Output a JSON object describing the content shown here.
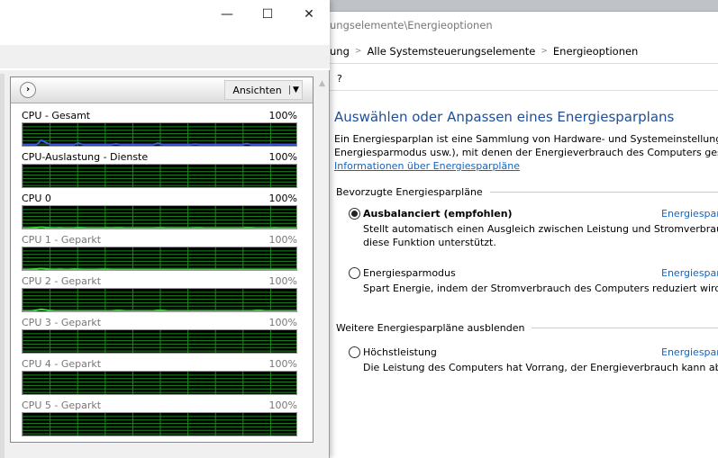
{
  "explorer": {
    "title": "ungselemente\\Energieoptionen",
    "breadcrumb": [
      "ung",
      "Alle Systemsteuerungselemente",
      "Energieoptionen"
    ],
    "help": "?",
    "heading": "Auswählen oder Anpassen eines Energiesparplans",
    "intro": [
      "Ein Energiesparplan ist eine Sammlung von Hardware- und Systemeinstellungen (",
      "Energiesparmodus usw.), mit denen der Energieverbrauch des Computers gesteu"
    ],
    "intro_link": "Informationen über Energiesparpläne",
    "group_preferred": "Bevorzugte Energiesparpläne",
    "group_more": "Weitere Energiesparpläne ausblenden",
    "plans": [
      {
        "name": "Ausbalanciert (empfohlen)",
        "selected": true,
        "link": "Energiesparp",
        "desc": [
          "Stellt automatisch einen Ausgleich zwischen Leistung und Stromverbrauch",
          "diese Funktion unterstützt."
        ]
      },
      {
        "name": "Energiesparmodus",
        "selected": false,
        "link": "Energiesparp",
        "desc": [
          "Spart Energie, indem der Stromverbrauch des Computers reduziert wird, we"
        ]
      },
      {
        "name": "Höchstleistung",
        "selected": false,
        "link": "Energiesparp",
        "desc": [
          "Die Leistung des Computers hat Vorrang, der Energieverbrauch kann aber h"
        ]
      }
    ]
  },
  "monitor": {
    "window_buttons": {
      "minimize": "—",
      "maximize": "☐",
      "close": "✕"
    },
    "views_label": "Ansichten",
    "expand_icon": "›",
    "graphs": [
      {
        "label": "CPU - Gesamt",
        "max": "100%",
        "parked": false,
        "color": "#3a5de8",
        "usage": [
          5,
          5,
          5,
          5,
          25,
          15,
          5,
          5,
          5,
          5,
          5,
          5,
          12,
          5,
          5,
          5,
          5,
          5,
          5,
          5,
          8,
          5,
          5,
          5,
          5,
          5,
          5,
          5,
          5,
          12,
          5,
          5,
          5,
          5,
          5,
          5,
          5,
          7,
          5,
          5,
          5,
          5,
          5,
          5,
          5,
          5,
          5,
          5,
          10,
          5,
          5,
          5,
          5,
          5,
          6,
          5,
          5,
          5,
          5,
          5
        ]
      },
      {
        "label": "CPU-Auslastung - Dienste",
        "max": "100%",
        "parked": false,
        "color": "#3a5de8",
        "usage": []
      },
      {
        "label": "CPU 0",
        "max": "100%",
        "parked": false,
        "color": "#30e030",
        "usage": [
          1,
          1,
          2,
          4,
          6,
          4,
          2,
          1,
          2,
          1,
          1,
          1,
          3,
          2,
          1,
          1,
          1,
          1,
          2,
          1,
          2,
          2,
          1,
          1,
          1,
          1,
          1,
          1,
          1,
          2,
          2,
          1,
          1,
          1,
          1,
          1,
          1,
          2,
          2,
          1,
          1,
          1,
          1,
          1,
          1,
          1,
          1,
          1,
          3,
          2,
          1,
          1,
          1,
          1,
          2,
          1,
          1,
          1,
          1,
          1
        ]
      },
      {
        "label": "CPU 1 - Geparkt",
        "max": "100%",
        "parked": true,
        "color": "#30e030",
        "usage": [
          1,
          1,
          2,
          4,
          6,
          4,
          2,
          1,
          2,
          1,
          1,
          3,
          2,
          1,
          1,
          1,
          1,
          2,
          2,
          1,
          1,
          1,
          1,
          1,
          1,
          1,
          1,
          1,
          1,
          1,
          1,
          1,
          1,
          1,
          1,
          1,
          1,
          1,
          1,
          1,
          1,
          1,
          1,
          1,
          1,
          1,
          1,
          1,
          1,
          1,
          1,
          1,
          1,
          1,
          1,
          1,
          1,
          1,
          1,
          1
        ]
      },
      {
        "label": "CPU 2 - Geparkt",
        "max": "100%",
        "parked": true,
        "color": "#30e030",
        "usage": [
          0,
          0,
          0,
          5,
          9,
          6,
          2,
          0,
          0,
          0,
          0,
          0,
          0,
          0,
          0,
          0,
          0,
          0,
          0,
          0,
          2,
          2,
          0,
          0,
          0,
          0,
          0,
          0,
          0,
          3,
          3,
          0,
          0,
          0,
          0,
          0,
          0,
          0,
          0,
          0,
          0,
          0,
          0,
          0,
          0,
          0,
          0,
          0,
          0,
          0,
          2,
          2,
          0,
          0,
          0,
          0,
          0,
          0,
          0,
          0
        ]
      },
      {
        "label": "CPU 3 - Geparkt",
        "max": "100%",
        "parked": true,
        "color": "#30e030",
        "usage": []
      },
      {
        "label": "CPU 4 - Geparkt",
        "max": "100%",
        "parked": true,
        "color": "#30e030",
        "usage": []
      },
      {
        "label": "CPU 5 - Geparkt",
        "max": "100%",
        "parked": true,
        "color": "#30e030",
        "usage": []
      }
    ]
  }
}
